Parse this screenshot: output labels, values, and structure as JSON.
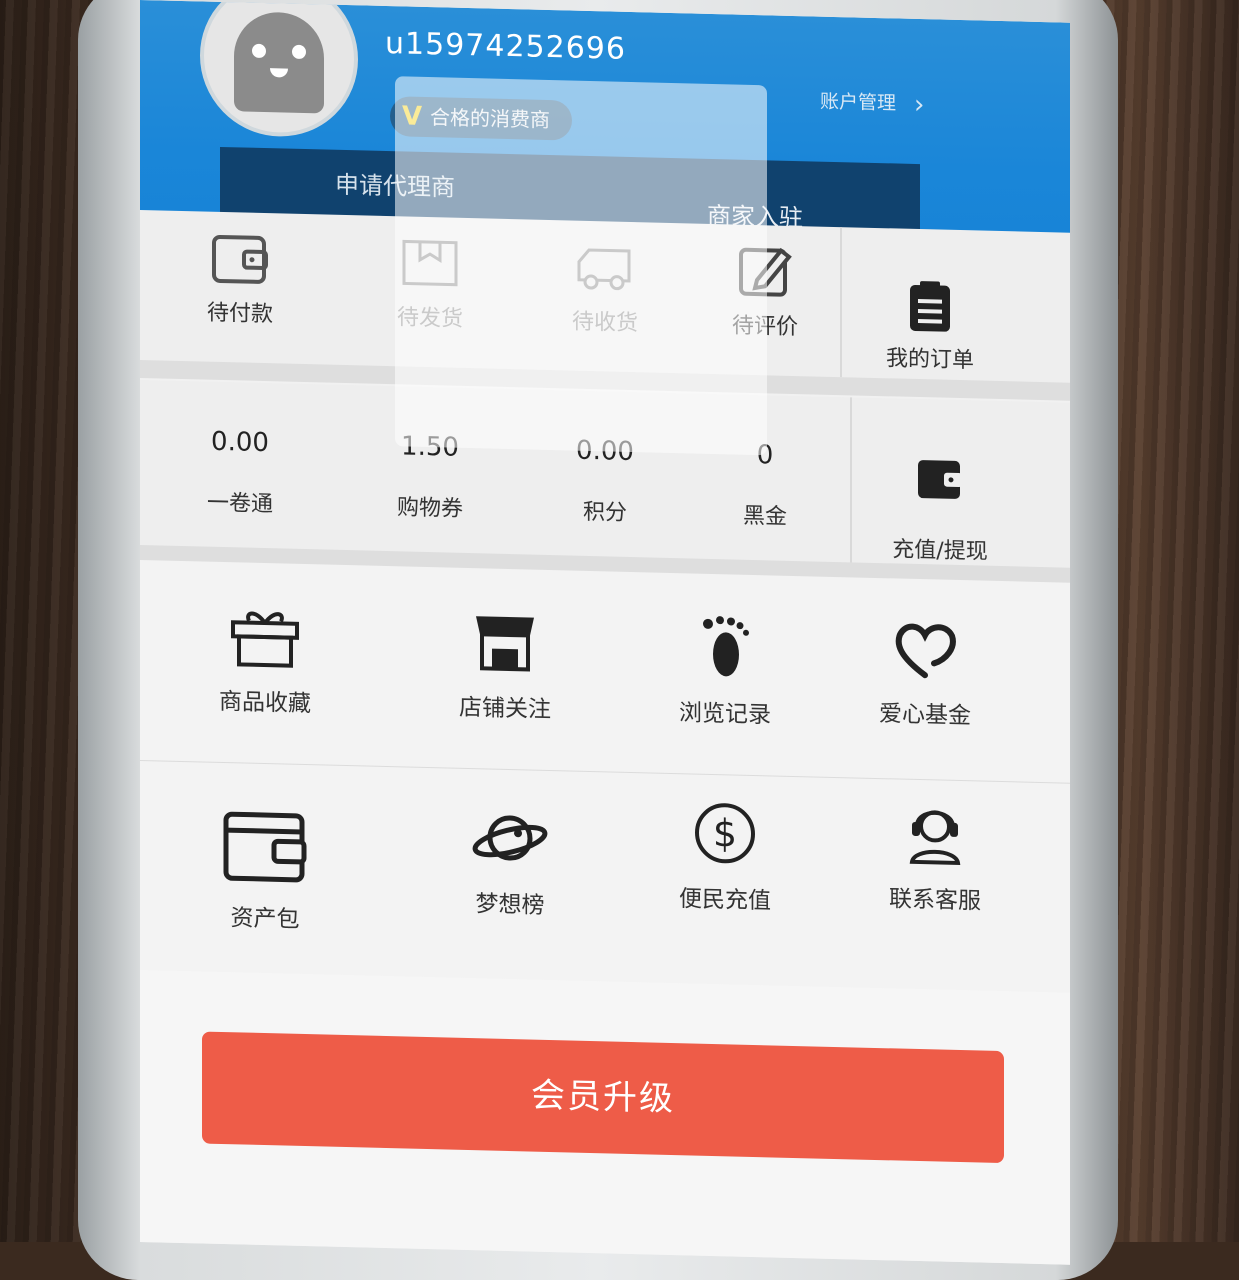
{
  "profile": {
    "username": "u15974252696",
    "badge_mark": "V",
    "badge_label": "合格的消费商",
    "account_label": "账户管理",
    "account_chevron": "›"
  },
  "tabs": {
    "agent": "申请代理商",
    "merchant": "商家入驻"
  },
  "orders": {
    "items": [
      {
        "label": "待付款",
        "icon": "wallet-icon"
      },
      {
        "label": "待发货",
        "icon": "package-icon"
      },
      {
        "label": "待收货",
        "icon": "truck-icon"
      },
      {
        "label": "待评价",
        "icon": "edit-icon"
      },
      {
        "label": "我的订单",
        "icon": "clipboard-icon"
      }
    ]
  },
  "wallet": {
    "items": [
      {
        "value": "0.00",
        "label": "一卷通"
      },
      {
        "value": "1.50",
        "label": "购物券"
      },
      {
        "value": "0.00",
        "label": "积分"
      },
      {
        "value": "0",
        "label": "黑金"
      }
    ],
    "recharge_label": "充值/提现"
  },
  "services": {
    "row1": [
      {
        "label": "商品收藏",
        "icon": "gift-icon"
      },
      {
        "label": "店铺关注",
        "icon": "store-icon"
      },
      {
        "label": "浏览记录",
        "icon": "footprint-icon"
      },
      {
        "label": "爱心基金",
        "icon": "heart-icon"
      }
    ],
    "row2": [
      {
        "label": "资产包",
        "icon": "wallet-icon"
      },
      {
        "label": "梦想榜",
        "icon": "planet-icon"
      },
      {
        "label": "便民充值",
        "icon": "dollar-icon"
      },
      {
        "label": "联系客服",
        "icon": "headset-icon"
      }
    ]
  },
  "upgrade_button": "会员升级",
  "colors": {
    "header_blue": "#1a86d8",
    "tab_navy": "#10426e",
    "upgrade_red": "#ee5c48",
    "badge_mark": "#f3d21c"
  }
}
